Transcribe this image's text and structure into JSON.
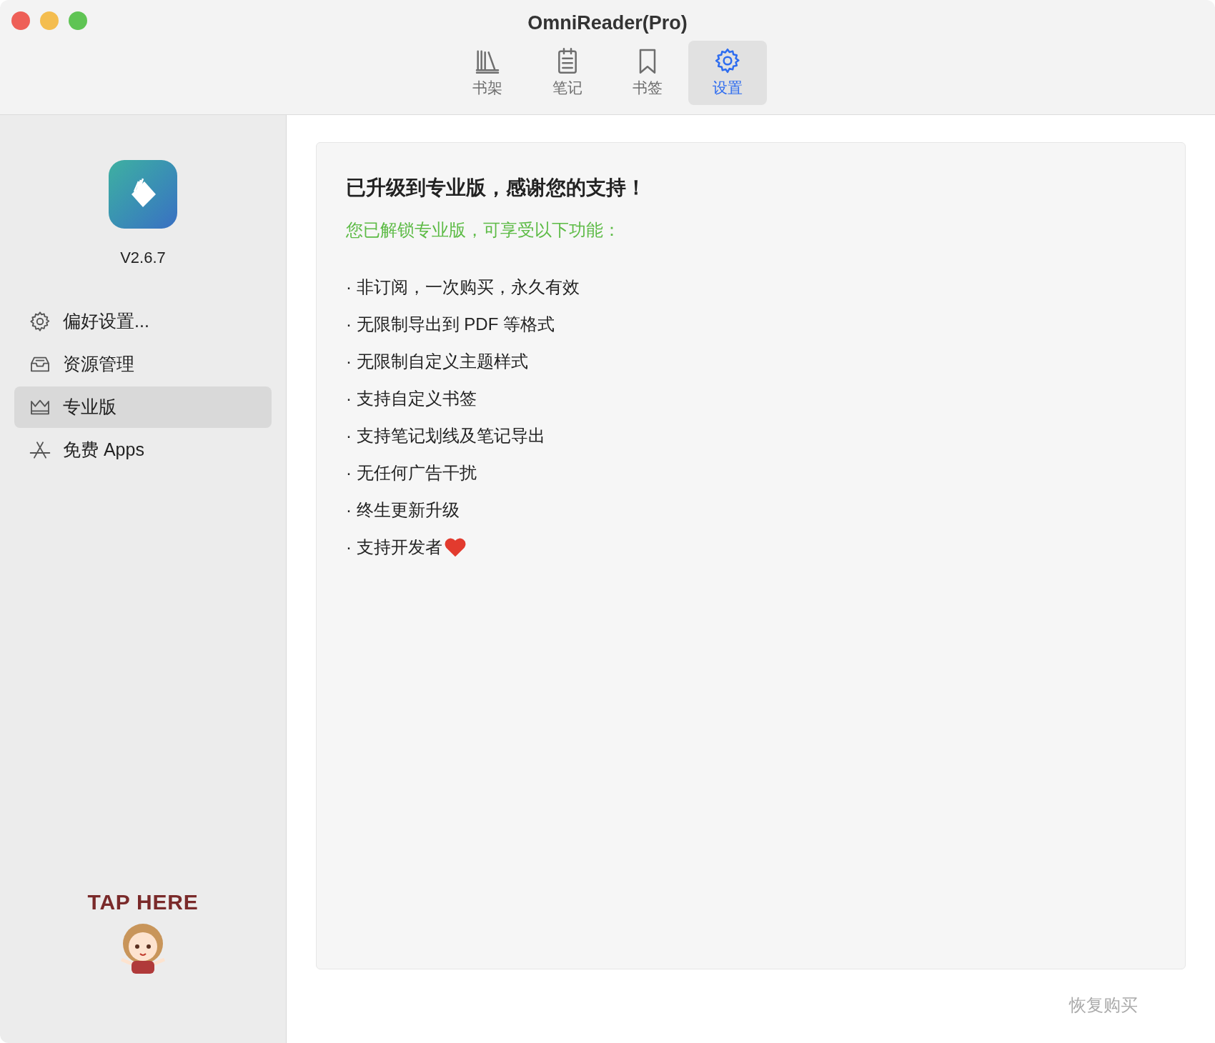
{
  "window": {
    "title": "OmniReader(Pro)"
  },
  "toolbar": [
    {
      "label": "书架",
      "kind": "books",
      "selected": false
    },
    {
      "label": "笔记",
      "kind": "notes",
      "selected": false
    },
    {
      "label": "书签",
      "kind": "bookmark",
      "selected": false
    },
    {
      "label": "设置",
      "kind": "gear",
      "selected": true
    }
  ],
  "sidebar": {
    "version": "V2.6.7",
    "items": [
      {
        "label": "偏好设置...",
        "kind": "gear",
        "selected": false
      },
      {
        "label": "资源管理",
        "kind": "tray",
        "selected": false
      },
      {
        "label": "专业版",
        "kind": "crown",
        "selected": true
      },
      {
        "label": "免费 Apps",
        "kind": "appstore",
        "selected": false
      }
    ],
    "sticker": {
      "text": "TAP HERE"
    }
  },
  "content": {
    "title": "已升级到专业版，感谢您的支持！",
    "subtitle": "您已解锁专业版，可享受以下功能：",
    "features": [
      {
        "text": "· 非订阅，一次购买，永久有效",
        "heart": false
      },
      {
        "text": "· 无限制导出到 PDF 等格式",
        "heart": false
      },
      {
        "text": "· 无限制自定义主题样式",
        "heart": false
      },
      {
        "text": "· 支持自定义书签",
        "heart": false
      },
      {
        "text": "· 支持笔记划线及笔记导出",
        "heart": false
      },
      {
        "text": "· 无任何广告干扰",
        "heart": false
      },
      {
        "text": "· 终生更新升级",
        "heart": false
      },
      {
        "text": "· 支持开发者",
        "heart": true
      }
    ]
  },
  "restore_button": "恢复购买"
}
